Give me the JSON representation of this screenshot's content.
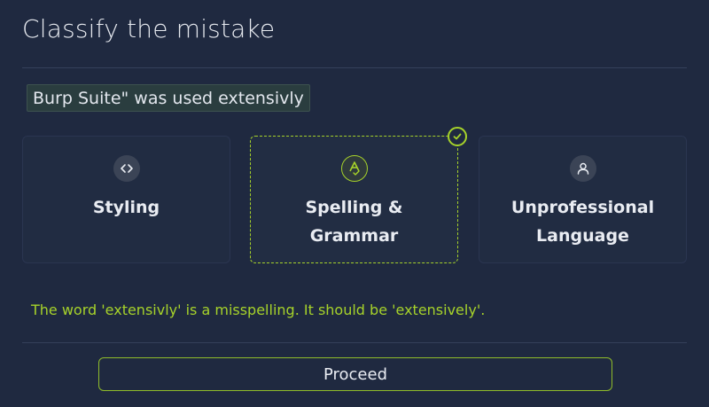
{
  "title": "Classify the mistake",
  "excerpt": "Burp Suite\" was used extensivly",
  "options": [
    {
      "label": "Styling",
      "icon": "code-icon",
      "selected": false
    },
    {
      "label": "Spelling & Grammar",
      "icon": "spellcheck-icon",
      "selected": true
    },
    {
      "label": "Unprofessional Language",
      "icon": "user-icon",
      "selected": false
    }
  ],
  "feedback": "The word 'extensivly' is a misspelling. It should be 'extensively'.",
  "proceed_label": "Proceed",
  "colors": {
    "background": "#1f2940",
    "accent": "#a6d22a",
    "card": "#212c42",
    "text": "#e9ecf2"
  }
}
